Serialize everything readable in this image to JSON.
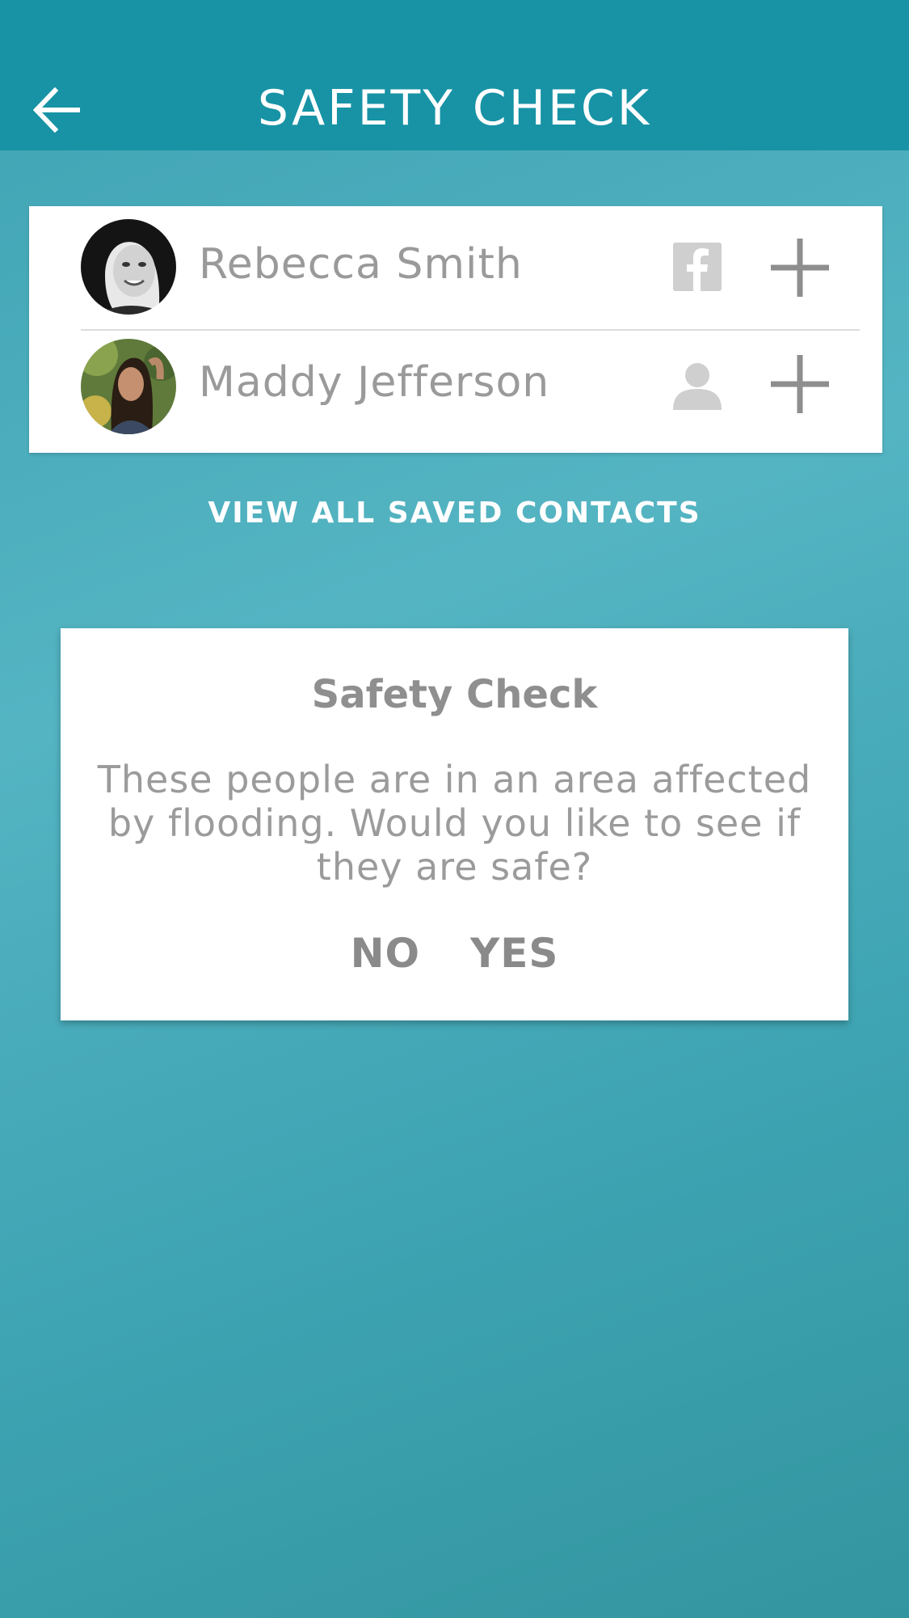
{
  "header": {
    "title": "SAFETY CHECK",
    "back_icon": "arrow-left-icon"
  },
  "contacts": [
    {
      "name": "Rebecca Smith",
      "source_icon": "facebook-icon",
      "action_icon": "plus-icon"
    },
    {
      "name": "Maddy Jefferson",
      "source_icon": "person-icon",
      "action_icon": "plus-icon"
    }
  ],
  "view_all_label": "VIEW ALL SAVED CONTACTS",
  "dialog": {
    "title": "Safety Check",
    "body": "These people are in an area affected by flooding. Would you like to see if they are safe?",
    "no_label": "NO",
    "yes_label": "YES"
  },
  "colors": {
    "header_bg": "#1793a5",
    "background": "#4aacbb",
    "card_text": "#9a9a9a",
    "icon_gray": "#8e8e8e"
  }
}
